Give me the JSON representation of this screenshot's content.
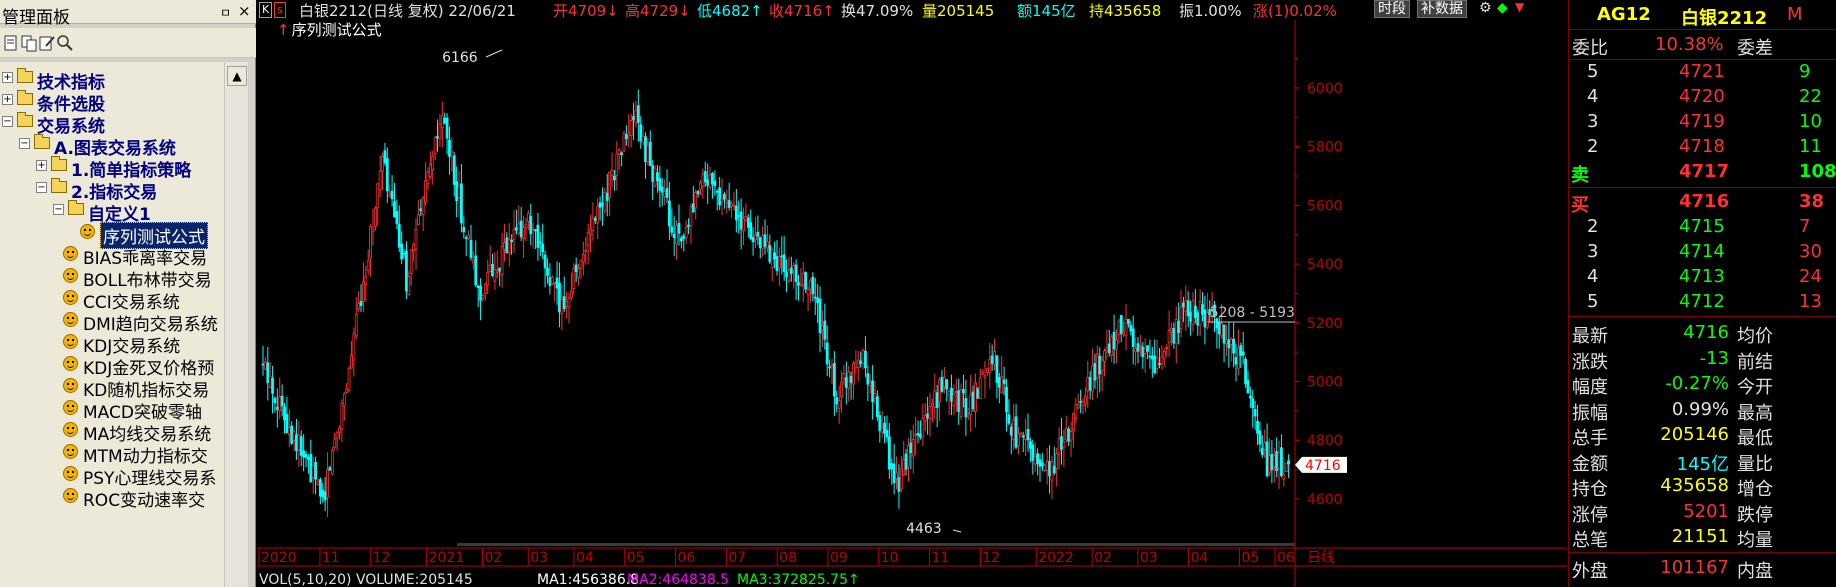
{
  "panel": {
    "title": "管理面板",
    "pin_icon": "pin-icon",
    "close_icon": "close-icon",
    "scroll_up": "▲"
  },
  "tree": [
    {
      "label": "技术指标",
      "level": 0,
      "kind": "folder",
      "expander": "+",
      "bold": true
    },
    {
      "label": "条件选股",
      "level": 0,
      "kind": "folder",
      "expander": "+",
      "bold": true
    },
    {
      "label": "交易系统",
      "level": 0,
      "kind": "folder",
      "expander": "−",
      "bold": true
    },
    {
      "label": "A.图表交易系统",
      "level": 1,
      "kind": "folder",
      "expander": "−",
      "bold": true
    },
    {
      "label": "1.简单指标策略",
      "level": 2,
      "kind": "folder",
      "expander": "+",
      "bold": true
    },
    {
      "label": "2.指标交易",
      "level": 2,
      "kind": "folder",
      "expander": "−",
      "bold": true
    },
    {
      "label": "自定义1",
      "level": 3,
      "kind": "folder",
      "expander": "−",
      "bold": true
    },
    {
      "label": "序列测试公式",
      "level": 4,
      "kind": "item",
      "selected": true
    },
    {
      "label": "BIAS乖离率交易",
      "level": 3,
      "kind": "item"
    },
    {
      "label": "BOLL布林带交易",
      "level": 3,
      "kind": "item"
    },
    {
      "label": "CCI交易系统",
      "level": 3,
      "kind": "item"
    },
    {
      "label": "DMI趋向交易系统",
      "level": 3,
      "kind": "item"
    },
    {
      "label": "KDJ交易系统",
      "level": 3,
      "kind": "item"
    },
    {
      "label": "KDJ金死叉价格预",
      "level": 3,
      "kind": "item"
    },
    {
      "label": "KD随机指标交易",
      "level": 3,
      "kind": "item"
    },
    {
      "label": "MACD突破零轴",
      "level": 3,
      "kind": "item"
    },
    {
      "label": "MA均线交易系统",
      "level": 3,
      "kind": "item"
    },
    {
      "label": "MTM动力指标交",
      "level": 3,
      "kind": "item"
    },
    {
      "label": "PSY心理线交易系",
      "level": 3,
      "kind": "item"
    },
    {
      "label": "ROC变动速率交",
      "level": 3,
      "kind": "item"
    }
  ],
  "header": {
    "k_box": "K",
    "s_box": "s",
    "name": "白银2212(日线 复权) 22/06/21",
    "open": "开4709↓",
    "high": "高4729↓",
    "low": "低4682↑",
    "close": "收4716↑",
    "turnover": "换47.09%",
    "volume": "量205145",
    "amount": "额145亿",
    "hold": "持435658",
    "amplitude": "振1.00%",
    "change": "涨(1)0.02%",
    "btn_period": "时段",
    "btn_data": "补数据"
  },
  "formula_label": "序列测试公式",
  "chart_data": {
    "type": "candlestick",
    "y_ticks": [
      "6000",
      "5800",
      "5600",
      "5400",
      "5200",
      "5000",
      "4800",
      "4600"
    ],
    "y_tick_values": [
      6000,
      5800,
      5600,
      5400,
      5200,
      5000,
      4800,
      4600
    ],
    "ylim": [
      4460,
      6170
    ],
    "x_ticks": [
      "2020",
      "11",
      "12",
      "2021",
      "02",
      "03",
      "04",
      "05",
      "06",
      "07",
      "08",
      "09",
      "10",
      "11",
      "12",
      "2022",
      "02",
      "03",
      "04",
      "05",
      "06"
    ],
    "x_tick_fracs": [
      0.0,
      0.06,
      0.11,
      0.165,
      0.22,
      0.265,
      0.31,
      0.36,
      0.41,
      0.46,
      0.51,
      0.56,
      0.61,
      0.66,
      0.71,
      0.765,
      0.82,
      0.865,
      0.915,
      0.965,
      1.0
    ],
    "period_label": "日线",
    "last_price": "4716",
    "high_annotation": "6166",
    "low_annotation": "4463",
    "range_annotation": "5208 - 5193",
    "bar_count": 430,
    "seed": 13,
    "path": [
      [
        0,
        5050
      ],
      [
        25,
        4600
      ],
      [
        35,
        5000
      ],
      [
        50,
        5750
      ],
      [
        60,
        5350
      ],
      [
        75,
        5900
      ],
      [
        90,
        5300
      ],
      [
        110,
        5550
      ],
      [
        125,
        5250
      ],
      [
        155,
        5900
      ],
      [
        175,
        5450
      ],
      [
        185,
        5700
      ],
      [
        210,
        5450
      ],
      [
        230,
        5300
      ],
      [
        240,
        4950
      ],
      [
        250,
        5100
      ],
      [
        265,
        4650
      ],
      [
        285,
        5000
      ],
      [
        295,
        4900
      ],
      [
        305,
        5100
      ],
      [
        315,
        4800
      ],
      [
        330,
        4700
      ],
      [
        345,
        5000
      ],
      [
        360,
        5200
      ],
      [
        375,
        5050
      ],
      [
        385,
        5250
      ],
      [
        400,
        5200
      ],
      [
        410,
        5050
      ],
      [
        420,
        4720
      ],
      [
        429,
        4716
      ]
    ]
  },
  "indicator_row": {
    "vol": "VOL(5,10,20) VOLUME:205145",
    "ma1": "MA1:456386.8",
    "ma2": "MA2:464838.5",
    "ma3": "MA3:372825.75↑"
  },
  "quote": {
    "code": "AG12",
    "name": "白银2212",
    "flag": "M",
    "ratio_label": "委比",
    "ratio_value": "10.38%",
    "diff_label": "委差",
    "diff_value": "",
    "asks": [
      {
        "level": "5",
        "price": "4721",
        "qty": "9"
      },
      {
        "level": "4",
        "price": "4720",
        "qty": "22"
      },
      {
        "level": "3",
        "price": "4719",
        "qty": "10"
      },
      {
        "level": "2",
        "price": "4718",
        "qty": "11"
      },
      {
        "level": "卖",
        "price": "4717",
        "qty": "108"
      }
    ],
    "bids": [
      {
        "level": "买",
        "price": "4716",
        "qty": "38"
      },
      {
        "level": "2",
        "price": "4715",
        "qty": "7"
      },
      {
        "level": "3",
        "price": "4714",
        "qty": "30"
      },
      {
        "level": "4",
        "price": "4713",
        "qty": "24"
      },
      {
        "level": "5",
        "price": "4712",
        "qty": "13"
      }
    ],
    "stats": [
      {
        "l1": "最新",
        "v1": "4716",
        "c1": "c-green",
        "l2": "均价"
      },
      {
        "l1": "涨跌",
        "v1": "-13",
        "c1": "c-green",
        "l2": "前结"
      },
      {
        "l1": "幅度",
        "v1": "-0.27%",
        "c1": "c-green",
        "l2": "今开"
      },
      {
        "l1": "振幅",
        "v1": "0.99%",
        "c1": "c-white",
        "l2": "最高"
      },
      {
        "l1": "总手",
        "v1": "205146",
        "c1": "c-yellow",
        "l2": "最低"
      },
      {
        "l1": "金额",
        "v1": "145亿",
        "c1": "c-cyan",
        "l2": "量比"
      },
      {
        "l1": "持仓",
        "v1": "435658",
        "c1": "c-yellow",
        "l2": "增仓"
      },
      {
        "l1": "涨停",
        "v1": "5201",
        "c1": "c-red",
        "l2": "跌停"
      },
      {
        "l1": "总笔",
        "v1": "21151",
        "c1": "c-yellow",
        "l2": "均量"
      }
    ],
    "out_label": "外盘",
    "out_value": "101167",
    "in_label": "内盘",
    "in_value": ""
  },
  "colors": {
    "up": "#ff3030",
    "down": "#00ffff",
    "axis": "#c00000",
    "text": "#e0e0e0"
  }
}
